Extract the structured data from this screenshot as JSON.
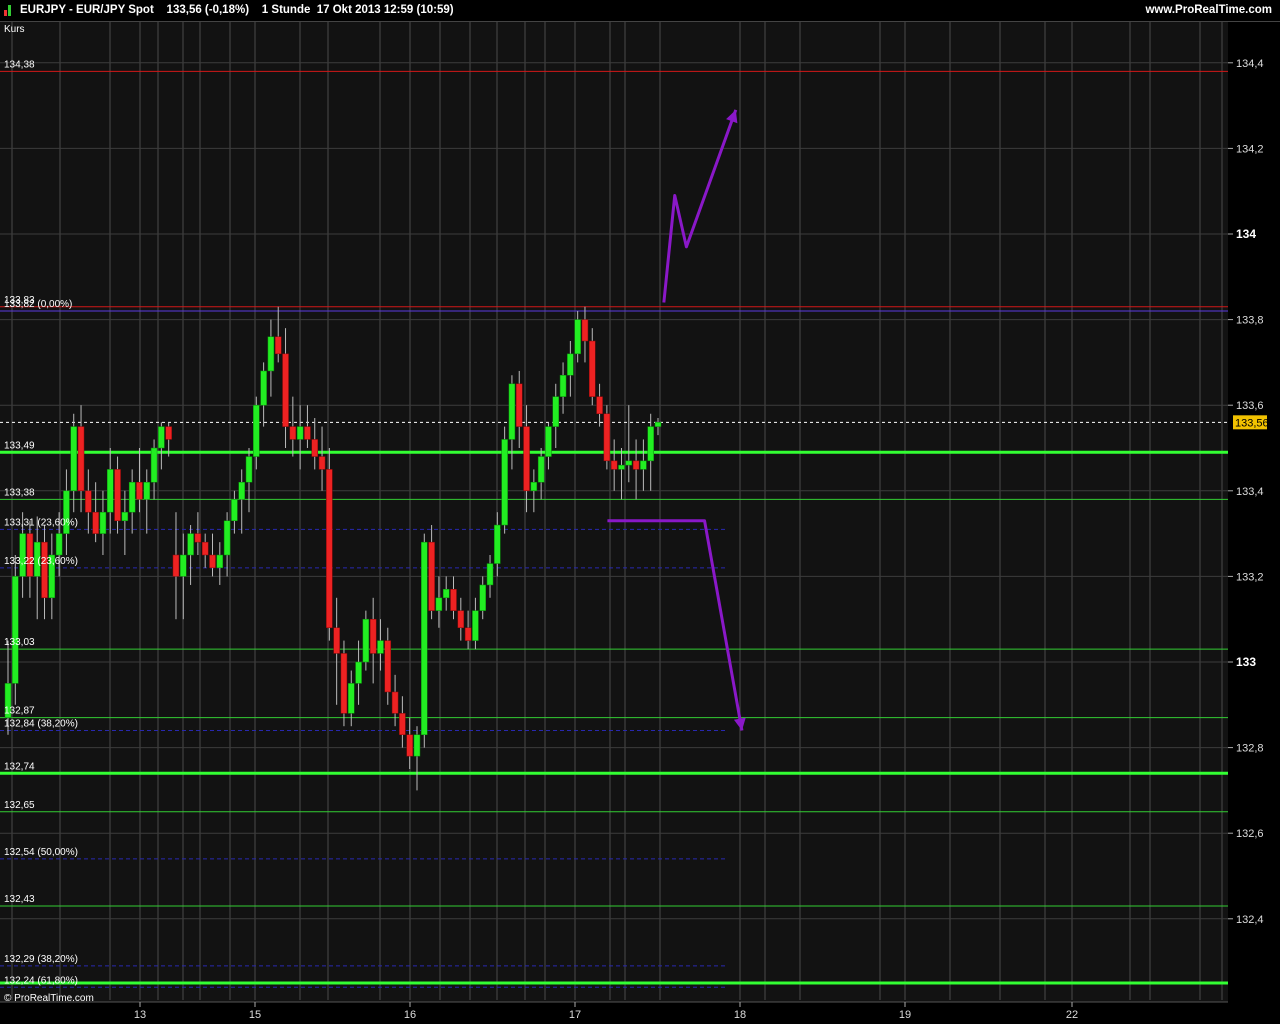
{
  "header": {
    "title": "EURJPY - EUR/JPY Spot    133,56 (-0,18%)    1 Stunde  17 Okt 2013 12:59 (10:59)",
    "site": "www.ProRealTime.com"
  },
  "chart_data": {
    "type": "candlestick",
    "panel_label": "Kurs",
    "watermark": "© ProRealTime.com",
    "ylim": [
      132.25,
      134.61
    ],
    "y_ticks": [
      {
        "v": 134.4,
        "label": "134,4",
        "bold": false
      },
      {
        "v": 134.2,
        "label": "134,2",
        "bold": false
      },
      {
        "v": 134.0,
        "label": "134",
        "bold": true
      },
      {
        "v": 133.8,
        "label": "133,8",
        "bold": false
      },
      {
        "v": 133.6,
        "label": "133,6",
        "bold": false
      },
      {
        "v": 133.4,
        "label": "133,4",
        "bold": false
      },
      {
        "v": 133.2,
        "label": "133,2",
        "bold": false
      },
      {
        "v": 133.0,
        "label": "133",
        "bold": true
      },
      {
        "v": 132.8,
        "label": "132,8",
        "bold": false
      },
      {
        "v": 132.6,
        "label": "132,6",
        "bold": false
      },
      {
        "v": 132.4,
        "label": "132,4",
        "bold": false
      }
    ],
    "x_ticks": [
      "13",
      "15",
      "16",
      "17",
      "18",
      "19",
      "22"
    ],
    "current_price": {
      "value": 133.56,
      "label": "133,56"
    },
    "horizontal_lines": [
      {
        "v": 134.38,
        "label": "134,38",
        "color": "#d01818",
        "style": "solid",
        "width": 1
      },
      {
        "v": 133.83,
        "label": "133,83",
        "color": "#d01818",
        "style": "solid",
        "width": 1
      },
      {
        "v": 133.82,
        "label": "133,82 (0,00%)",
        "color": "#5a3ae0",
        "style": "solid",
        "width": 1
      },
      {
        "v": 133.49,
        "label": "133,49",
        "color": "#33ff33",
        "style": "solid",
        "width": 3
      },
      {
        "v": 133.38,
        "label": "133,38",
        "color": "#33cc33",
        "style": "solid",
        "width": 1
      },
      {
        "v": 133.31,
        "label": "133,31 (23,60%)",
        "color": "#2828b0",
        "style": "dashed",
        "width": 1
      },
      {
        "v": 133.22,
        "label": "133,22 (23,60%)",
        "color": "#2828b0",
        "style": "dashed",
        "width": 1
      },
      {
        "v": 133.03,
        "label": "133,03",
        "color": "#33cc33",
        "style": "solid",
        "width": 1
      },
      {
        "v": 132.87,
        "label": "132,87",
        "color": "#33cc33",
        "style": "solid",
        "width": 1
      },
      {
        "v": 132.84,
        "label": "132,84 (38,20%)",
        "color": "#2828b0",
        "style": "dashed",
        "width": 1
      },
      {
        "v": 132.74,
        "label": "132,74",
        "color": "#33ff33",
        "style": "solid",
        "width": 3
      },
      {
        "v": 132.65,
        "label": "132,65",
        "color": "#33cc33",
        "style": "solid",
        "width": 1
      },
      {
        "v": 132.54,
        "label": "132,54 (50,00%)",
        "color": "#2828b0",
        "style": "dashed",
        "width": 1
      },
      {
        "v": 132.43,
        "label": "132,43",
        "color": "#33cc33",
        "style": "solid",
        "width": 1
      },
      {
        "v": 132.29,
        "label": "132,29 (38,20%)",
        "color": "#2828b0",
        "style": "dashed",
        "width": 1
      },
      {
        "v": 132.24,
        "label": "132,24 (61,80%)",
        "color": "#2828b0",
        "style": "dashed",
        "width": 1
      },
      {
        "v": 132.25,
        "label": "",
        "color": "#33ff33",
        "style": "solid",
        "width": 3
      }
    ],
    "candles": [
      [
        132.87,
        133.05,
        132.83,
        132.95
      ],
      [
        132.95,
        133.25,
        132.9,
        133.2
      ],
      [
        133.2,
        133.35,
        133.15,
        133.3
      ],
      [
        133.3,
        133.33,
        133.15,
        133.2
      ],
      [
        133.2,
        133.34,
        133.1,
        133.28
      ],
      [
        133.28,
        133.32,
        133.1,
        133.15
      ],
      [
        133.15,
        133.3,
        133.1,
        133.25
      ],
      [
        133.25,
        133.35,
        133.2,
        133.3
      ],
      [
        133.3,
        133.45,
        133.25,
        133.4
      ],
      [
        133.4,
        133.58,
        133.35,
        133.55
      ],
      [
        133.55,
        133.6,
        133.35,
        133.4
      ],
      [
        133.4,
        133.45,
        133.3,
        133.35
      ],
      [
        133.35,
        133.42,
        133.28,
        133.3
      ],
      [
        133.3,
        133.4,
        133.25,
        133.35
      ],
      [
        133.35,
        133.5,
        133.3,
        133.45
      ],
      [
        133.45,
        133.48,
        133.3,
        133.33
      ],
      [
        133.33,
        133.4,
        133.25,
        133.35
      ],
      [
        133.35,
        133.45,
        133.3,
        133.42
      ],
      [
        133.42,
        133.5,
        133.35,
        133.38
      ],
      [
        133.38,
        133.45,
        133.3,
        133.42
      ],
      [
        133.42,
        133.52,
        133.38,
        133.5
      ],
      [
        133.5,
        133.56,
        133.45,
        133.55
      ],
      [
        133.55,
        133.56,
        133.48,
        133.52
      ],
      [
        133.25,
        133.35,
        133.1,
        133.2
      ],
      [
        133.2,
        133.3,
        133.1,
        133.25
      ],
      [
        133.25,
        133.32,
        133.18,
        133.3
      ],
      [
        133.3,
        133.35,
        133.25,
        133.28
      ],
      [
        133.28,
        133.3,
        133.22,
        133.25
      ],
      [
        133.25,
        133.3,
        133.2,
        133.22
      ],
      [
        133.22,
        133.28,
        133.18,
        133.25
      ],
      [
        133.25,
        133.35,
        133.2,
        133.33
      ],
      [
        133.33,
        133.4,
        133.3,
        133.38
      ],
      [
        133.38,
        133.45,
        133.3,
        133.42
      ],
      [
        133.42,
        133.5,
        133.35,
        133.48
      ],
      [
        133.48,
        133.62,
        133.45,
        133.6
      ],
      [
        133.6,
        133.7,
        133.55,
        133.68
      ],
      [
        133.68,
        133.8,
        133.62,
        133.76
      ],
      [
        133.76,
        133.83,
        133.7,
        133.72
      ],
      [
        133.72,
        133.78,
        133.5,
        133.55
      ],
      [
        133.55,
        133.62,
        133.48,
        133.52
      ],
      [
        133.52,
        133.6,
        133.45,
        133.55
      ],
      [
        133.55,
        133.6,
        133.5,
        133.52
      ],
      [
        133.52,
        133.57,
        133.45,
        133.48
      ],
      [
        133.48,
        133.55,
        133.4,
        133.45
      ],
      [
        133.45,
        133.5,
        133.05,
        133.08
      ],
      [
        133.08,
        133.15,
        132.9,
        133.02
      ],
      [
        133.02,
        133.05,
        132.85,
        132.88
      ],
      [
        132.88,
        132.98,
        132.85,
        132.95
      ],
      [
        132.95,
        133.05,
        132.9,
        133.0
      ],
      [
        133.0,
        133.12,
        132.98,
        133.1
      ],
      [
        133.1,
        133.15,
        132.95,
        133.02
      ],
      [
        133.02,
        133.1,
        132.98,
        133.05
      ],
      [
        133.05,
        133.08,
        132.9,
        132.93
      ],
      [
        132.93,
        132.97,
        132.85,
        132.88
      ],
      [
        132.88,
        132.92,
        132.8,
        132.83
      ],
      [
        132.83,
        132.87,
        132.75,
        132.78
      ],
      [
        132.78,
        132.85,
        132.7,
        132.83
      ],
      [
        132.83,
        133.3,
        132.8,
        133.28
      ],
      [
        133.28,
        133.32,
        133.1,
        133.12
      ],
      [
        133.12,
        133.2,
        133.08,
        133.15
      ],
      [
        133.15,
        133.2,
        133.12,
        133.17
      ],
      [
        133.17,
        133.2,
        133.1,
        133.12
      ],
      [
        133.12,
        133.15,
        133.05,
        133.08
      ],
      [
        133.08,
        133.12,
        133.03,
        133.05
      ],
      [
        133.05,
        133.15,
        133.03,
        133.12
      ],
      [
        133.12,
        133.2,
        133.1,
        133.18
      ],
      [
        133.18,
        133.25,
        133.15,
        133.23
      ],
      [
        133.23,
        133.35,
        133.2,
        133.32
      ],
      [
        133.32,
        133.55,
        133.3,
        133.52
      ],
      [
        133.52,
        133.67,
        133.45,
        133.65
      ],
      [
        133.65,
        133.68,
        133.5,
        133.55
      ],
      [
        133.55,
        133.6,
        133.35,
        133.4
      ],
      [
        133.4,
        133.45,
        133.35,
        133.42
      ],
      [
        133.42,
        133.5,
        133.38,
        133.48
      ],
      [
        133.48,
        133.56,
        133.45,
        133.55
      ],
      [
        133.55,
        133.65,
        133.5,
        133.62
      ],
      [
        133.62,
        133.7,
        133.58,
        133.67
      ],
      [
        133.67,
        133.75,
        133.62,
        133.72
      ],
      [
        133.72,
        133.82,
        133.7,
        133.8
      ],
      [
        133.8,
        133.83,
        133.7,
        133.75
      ],
      [
        133.75,
        133.78,
        133.6,
        133.62
      ],
      [
        133.62,
        133.65,
        133.55,
        133.58
      ],
      [
        133.58,
        133.6,
        133.45,
        133.47
      ],
      [
        133.47,
        133.52,
        133.4,
        133.45
      ],
      [
        133.45,
        133.5,
        133.38,
        133.46
      ],
      [
        133.46,
        133.6,
        133.42,
        133.47
      ],
      [
        133.47,
        133.52,
        133.38,
        133.45
      ],
      [
        133.45,
        133.52,
        133.4,
        133.47
      ],
      [
        133.47,
        133.58,
        133.4,
        133.55
      ],
      [
        133.55,
        133.57,
        133.53,
        133.56
      ]
    ],
    "annotations": [
      {
        "type": "up-zigzag-arrow",
        "color": "#8a18c8",
        "points": [
          [
            0.6035,
            133.84
          ],
          [
            0.6134,
            134.09
          ],
          [
            0.624,
            133.97
          ],
          [
            0.6689,
            134.29
          ]
        ]
      },
      {
        "type": "down-arrow",
        "color": "#8a18c8",
        "points": [
          [
            0.5522,
            133.33
          ],
          [
            0.6405,
            133.33
          ],
          [
            0.6745,
            132.84
          ]
        ]
      }
    ]
  }
}
